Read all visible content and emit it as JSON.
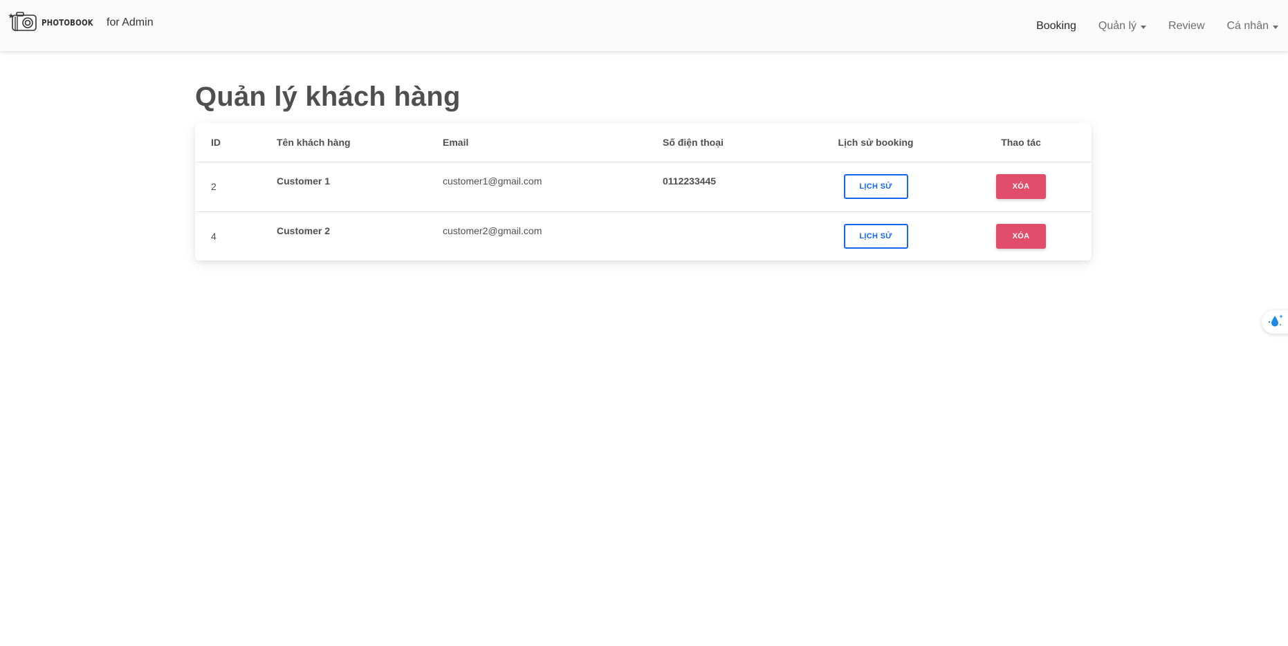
{
  "navbar": {
    "brand_logo_text": "PHOTOBOOK",
    "brand_suffix": "for Admin",
    "links": [
      {
        "label": "Booking",
        "active": true,
        "dropdown": false
      },
      {
        "label": "Quản lý",
        "active": false,
        "dropdown": true
      },
      {
        "label": "Review",
        "active": false,
        "dropdown": false
      },
      {
        "label": "Cá nhân",
        "active": false,
        "dropdown": true
      }
    ]
  },
  "page": {
    "title": "Quản lý khách hàng"
  },
  "table": {
    "headers": [
      "ID",
      "Tên khách hàng",
      "Email",
      "Số điện thoại",
      "Lịch sử booking",
      "Thao tác"
    ],
    "rows": [
      {
        "id": "2",
        "name": "Customer 1",
        "email": "customer1@gmail.com",
        "phone": "0112233445",
        "history_label": "LỊCH SỬ",
        "delete_label": "XÓA"
      },
      {
        "id": "4",
        "name": "Customer 2",
        "email": "customer2@gmail.com",
        "phone": "",
        "history_label": "LỊCH SỬ",
        "delete_label": "XÓA"
      }
    ]
  },
  "colors": {
    "primary": "#1266f1",
    "danger": "#e04e6c",
    "navbar_bg": "#fbfbfb",
    "text": "#4f4f4f"
  },
  "icons": {
    "brand": "camera-logo-icon",
    "caret": "caret-down-icon",
    "side_widget": "water-drop-sparkle-icon"
  }
}
